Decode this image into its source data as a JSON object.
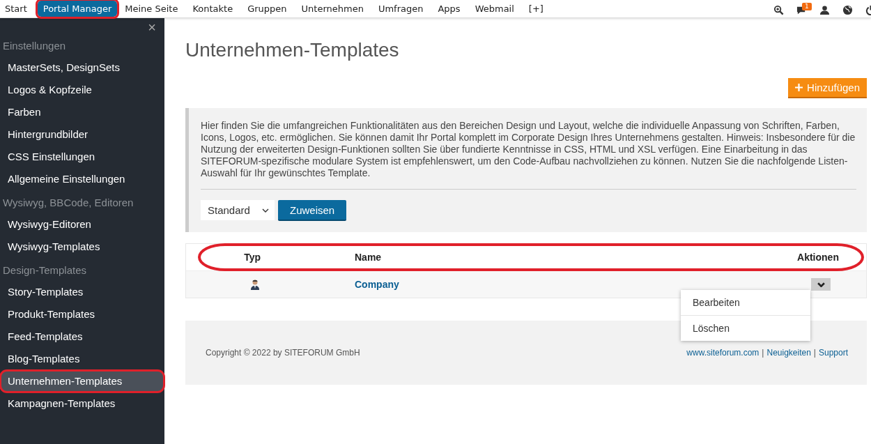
{
  "top_nav": {
    "items": [
      {
        "label": "Start",
        "selected": false,
        "highlighted": false
      },
      {
        "label": "Portal Manager",
        "selected": true,
        "highlighted": true
      },
      {
        "label": "Meine Seite",
        "selected": false,
        "highlighted": false
      },
      {
        "label": "Kontakte",
        "selected": false,
        "highlighted": false
      },
      {
        "label": "Gruppen",
        "selected": false,
        "highlighted": false
      },
      {
        "label": "Unternehmen",
        "selected": false,
        "highlighted": false
      },
      {
        "label": "Umfragen",
        "selected": false,
        "highlighted": false
      },
      {
        "label": "Apps",
        "selected": false,
        "highlighted": false
      },
      {
        "label": "Webmail",
        "selected": false,
        "highlighted": false
      },
      {
        "label": "[+]",
        "selected": false,
        "highlighted": false
      }
    ],
    "notification_count": "1"
  },
  "sidebar": {
    "close": "×",
    "sections": [
      {
        "heading": "Einstellungen",
        "items": [
          {
            "label": "MasterSets, DesignSets",
            "selected": false,
            "highlighted": false
          },
          {
            "label": "Logos & Kopfzeile",
            "selected": false,
            "highlighted": false
          },
          {
            "label": "Farben",
            "selected": false,
            "highlighted": false
          },
          {
            "label": "Hintergrundbilder",
            "selected": false,
            "highlighted": false
          },
          {
            "label": "CSS Einstellungen",
            "selected": false,
            "highlighted": false
          },
          {
            "label": "Allgemeine Einstellungen",
            "selected": false,
            "highlighted": false
          }
        ]
      },
      {
        "heading": "Wysiwyg, BBCode, Editoren",
        "items": [
          {
            "label": "Wysiwyg-Editoren",
            "selected": false,
            "highlighted": false
          },
          {
            "label": "Wysiwyg-Templates",
            "selected": false,
            "highlighted": false
          }
        ]
      },
      {
        "heading": "Design-Templates",
        "items": [
          {
            "label": "Story-Templates",
            "selected": false,
            "highlighted": false
          },
          {
            "label": "Produkt-Templates",
            "selected": false,
            "highlighted": false
          },
          {
            "label": "Feed-Templates",
            "selected": false,
            "highlighted": false
          },
          {
            "label": "Blog-Templates",
            "selected": false,
            "highlighted": false
          },
          {
            "label": "Unternehmen-Templates",
            "selected": true,
            "highlighted": true
          },
          {
            "label": "Kampagnen-Templates",
            "selected": false,
            "highlighted": false
          }
        ]
      }
    ]
  },
  "page": {
    "title": "Unternehmen-Templates",
    "add_button": "Hinzufügen",
    "info": "Hier finden Sie die umfangreichen Funktionalitäten aus den Bereichen Design und Layout, welche die individuelle Anpassung von Schriften, Farben, Icons, Logos, etc. ermöglichen. Sie können damit Ihr Portal komplett im Corporate Design Ihres Unternehmens gestalten. Hinweis: Insbesondere für die Nutzung der erweiterten Design-Funktionen sollten Sie über fundierte Kenntnisse in CSS, HTML und XSL verfügen. Eine Einarbeitung in das SITEFORUM-spezifische modulare System ist empfehlenswert, um den Code-Aufbau nachvollziehen zu können. Nutzen Sie die nachfolgende Listen-Auswahl für Ihr gewünschtes Template.",
    "select_value": "Standard",
    "assign_button": "Zuweisen"
  },
  "table": {
    "header_highlighted": true,
    "columns": [
      "Typ",
      "Name",
      "Aktionen"
    ],
    "rows": [
      {
        "name": "Company"
      }
    ]
  },
  "action_menu": {
    "items": [
      "Bearbeiten",
      "Löschen"
    ]
  },
  "footer": {
    "copyright": "Copyright © 2022 by SITEFORUM GmbH",
    "links": [
      "www.siteforum.com",
      "Neuigkeiten",
      "Support"
    ],
    "separator": "|"
  }
}
